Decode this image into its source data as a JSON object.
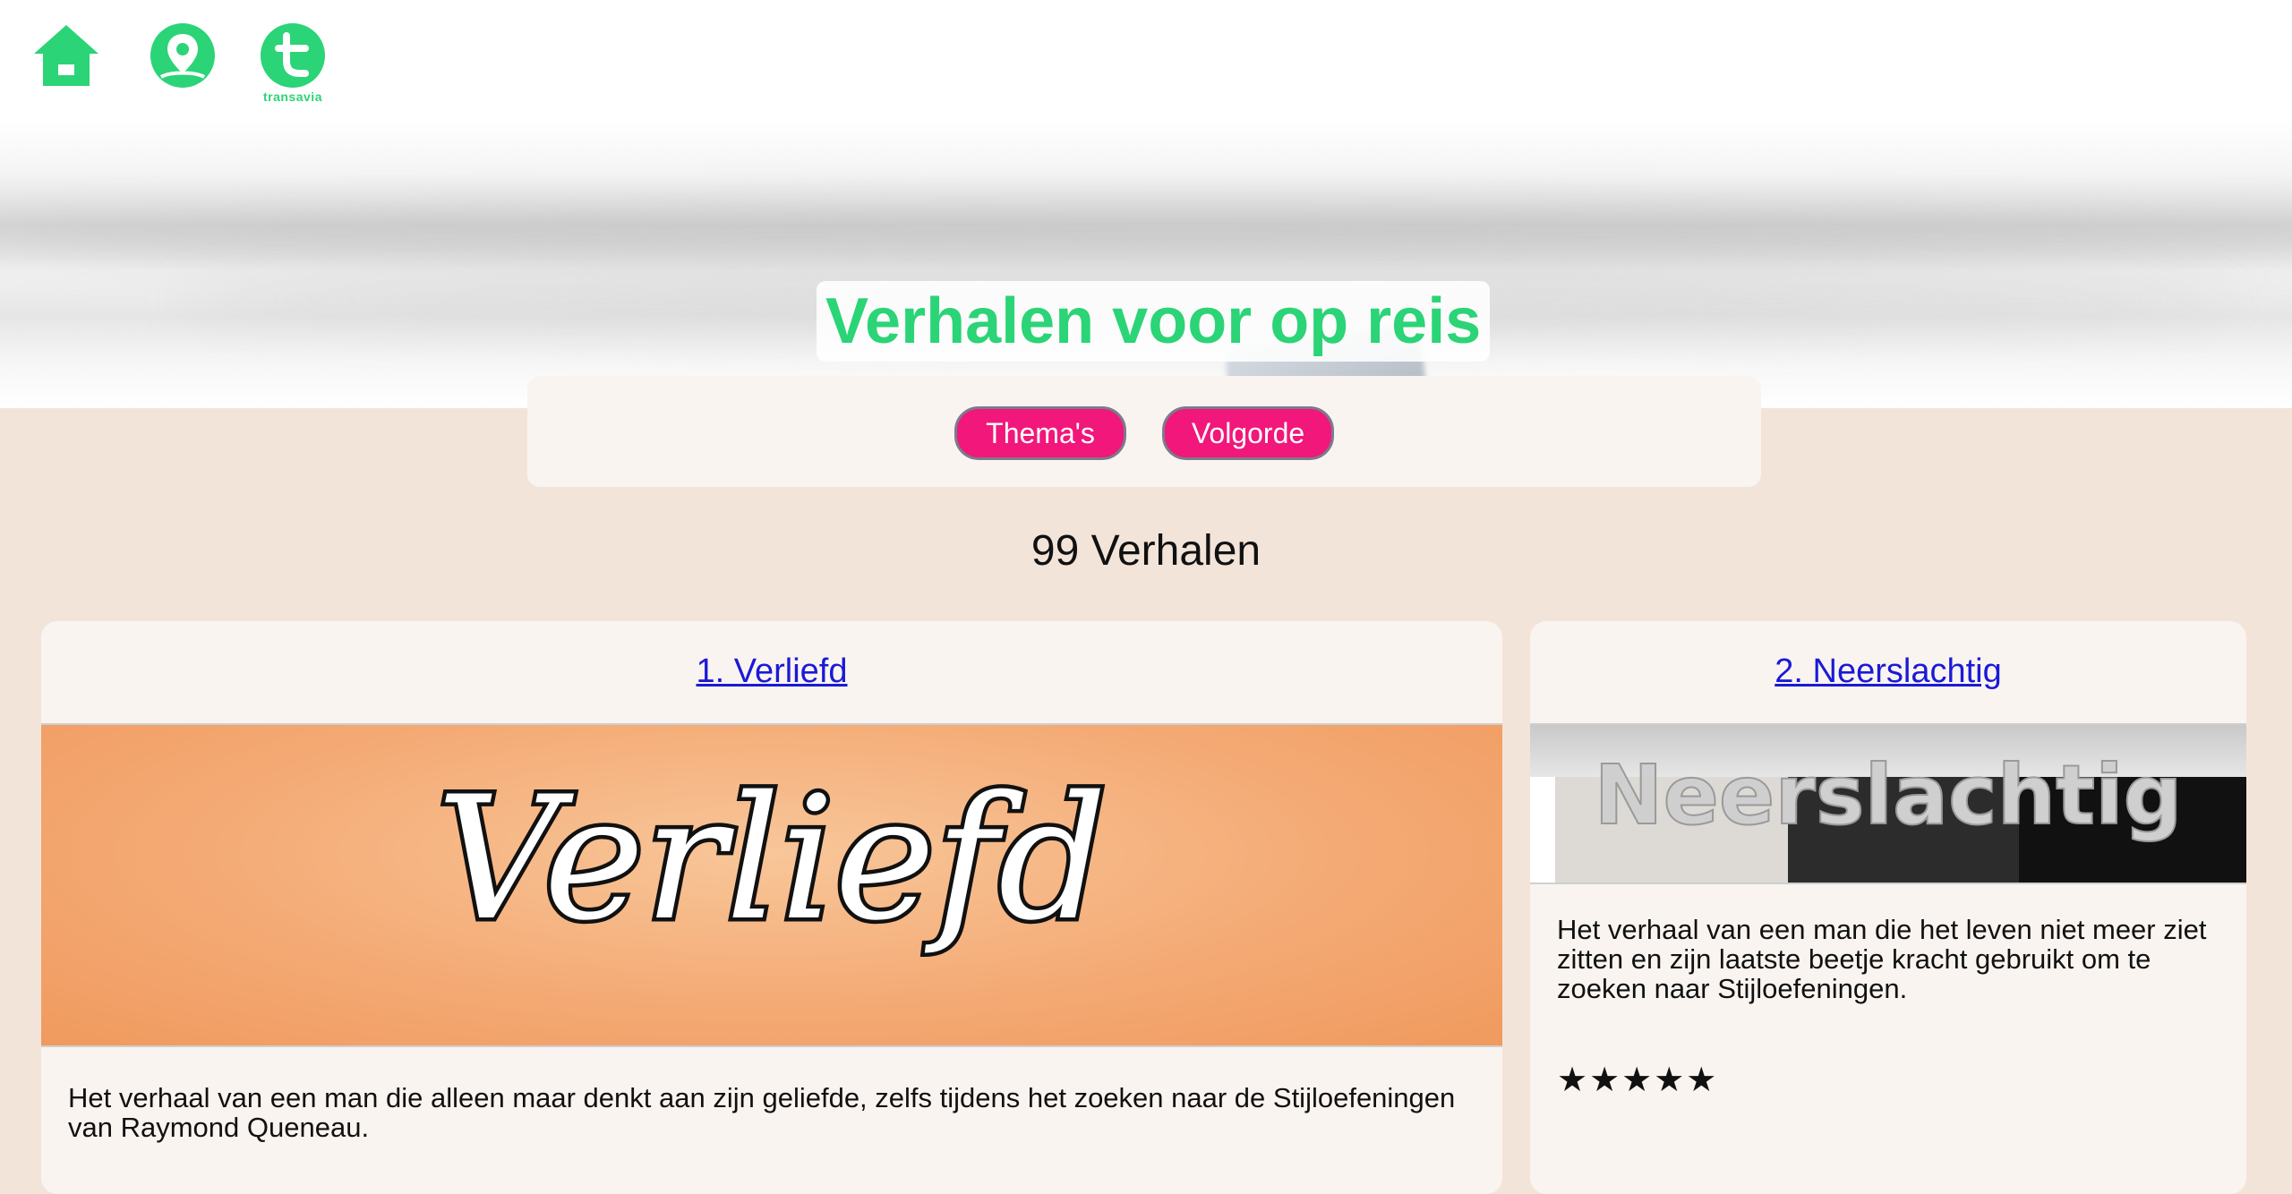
{
  "nav": {
    "home_icon": "home-icon",
    "profile_icon": "profile-pin-icon",
    "brand_icon": "transavia-logo",
    "brand_text": "transavia",
    "accent_color": "#2bd476"
  },
  "hero": {
    "title": "Verhalen voor op reis"
  },
  "filters": {
    "themas_label": "Thema's",
    "volgorde_label": "Volgorde",
    "pill_color": "#f1177b"
  },
  "results": {
    "count_text": "99 Verhalen"
  },
  "stories": [
    {
      "title": "1. Verliefd",
      "image_text": "Verliefd",
      "description": "Het verhaal van een man die alleen maar denkt aan zijn geliefde, zelfs tijdens het zoeken naar de Stijloefeningen van Raymond Queneau."
    },
    {
      "title": "2. Neerslachtig",
      "image_text": "Neerslachtig",
      "description": "Het verhaal van een man die het leven niet meer ziet zitten en zijn laatste beetje kracht gebruikt om te zoeken naar Stijloefeningen.",
      "rating_stars": "★★★★★"
    }
  ]
}
